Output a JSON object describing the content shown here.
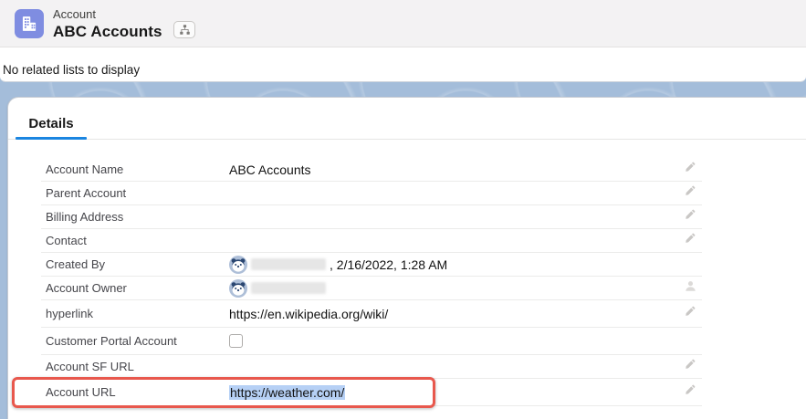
{
  "header": {
    "entity_label": "Account",
    "record_name": "ABC Accounts"
  },
  "related": {
    "message": "No related lists to display"
  },
  "tabs": {
    "details_label": "Details"
  },
  "fields": [
    {
      "label": "Account Name",
      "type": "text",
      "value": "ABC Accounts",
      "action": "edit",
      "tall": false
    },
    {
      "label": "Parent Account",
      "type": "text",
      "value": "",
      "action": "edit",
      "tall": false
    },
    {
      "label": "Billing Address",
      "type": "text",
      "value": "",
      "action": "edit",
      "tall": false
    },
    {
      "label": "Contact",
      "type": "text",
      "value": "",
      "action": "edit",
      "tall": false
    },
    {
      "label": "Created By",
      "type": "user",
      "redacted": true,
      "value_suffix": ", 2/16/2022, 1:28 AM",
      "action": "none",
      "tall": false
    },
    {
      "label": "Account Owner",
      "type": "user",
      "redacted": true,
      "value_suffix": "",
      "action": "change-owner",
      "tall": false
    },
    {
      "label": "hyperlink",
      "type": "text",
      "value": "https://en.wikipedia.org/wiki/",
      "action": "edit",
      "tall": true
    },
    {
      "label": "Customer Portal Account",
      "type": "checkbox",
      "checked": false,
      "action": "none",
      "tall": true
    },
    {
      "label": "Account SF URL",
      "type": "text",
      "value": "",
      "action": "edit",
      "tall": false
    },
    {
      "label": "Account URL",
      "type": "text",
      "value": "https://weather.com/",
      "action": "edit",
      "tall": true,
      "selected": true,
      "annotated": true
    }
  ],
  "colors": {
    "entity_icon_bg": "#7f8de1",
    "tab_accent_blue": "#1b85e0",
    "annotation_red": "#e8584d",
    "selection_blue": "#b6d0f5",
    "background_blue": "#a4bdda",
    "header_gray": "#f3f2f3"
  }
}
